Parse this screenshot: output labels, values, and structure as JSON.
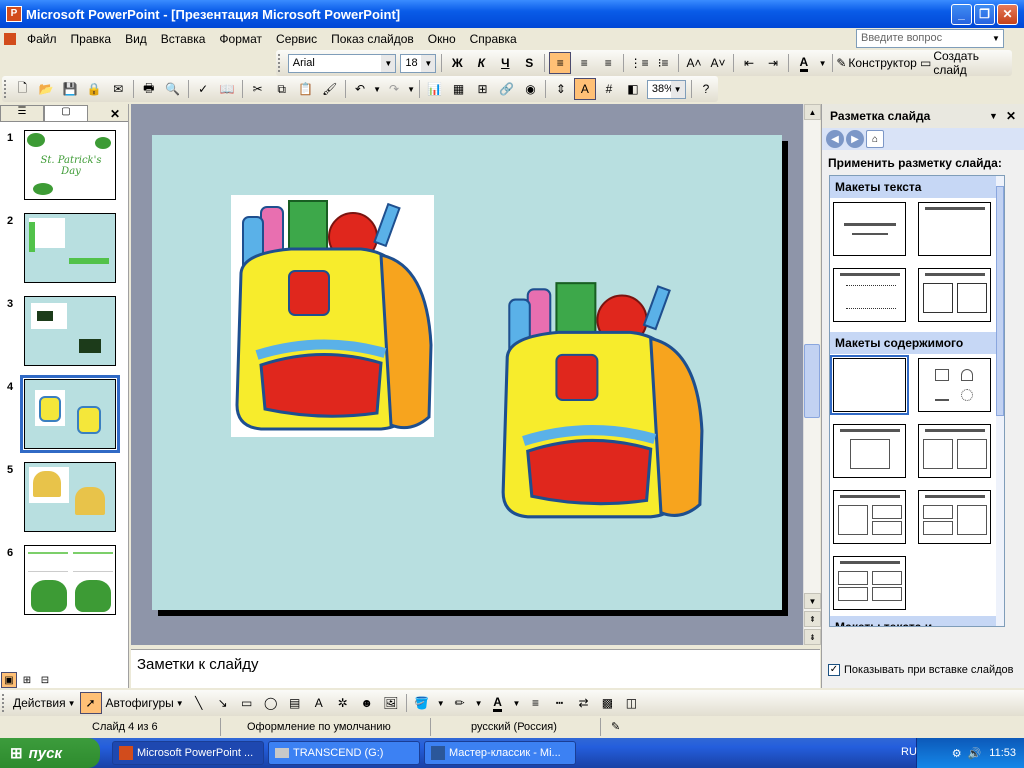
{
  "window": {
    "title": "Microsoft PowerPoint - [Презентация Microsoft PowerPoint]"
  },
  "menu": {
    "items": [
      "Файл",
      "Правка",
      "Вид",
      "Вставка",
      "Формат",
      "Сервис",
      "Показ слайдов",
      "Окно",
      "Справка"
    ],
    "ask_placeholder": "Введите вопрос"
  },
  "format_toolbar": {
    "font": "Arial",
    "size": "18",
    "bold": "Ж",
    "italic": "К",
    "underline": "Ч",
    "shadow": "S",
    "designer": "Конструктор",
    "new_slide": "Создать слайд"
  },
  "standard_toolbar": {
    "zoom": "38%"
  },
  "slides_pane": {
    "slides": [
      {
        "num": "1"
      },
      {
        "num": "2"
      },
      {
        "num": "3"
      },
      {
        "num": "4"
      },
      {
        "num": "5"
      },
      {
        "num": "6"
      }
    ],
    "thumb1_text": "St. Patrick's Day"
  },
  "notes": {
    "placeholder": "Заметки к слайду"
  },
  "task_pane": {
    "title": "Разметка слайда",
    "apply_label": "Применить разметку слайда:",
    "sections": {
      "text": "Макеты текста",
      "content": "Макеты содержимого",
      "text_content": "Макеты текста и содержимого"
    },
    "show_on_insert": "Показывать при вставке слайдов"
  },
  "draw_toolbar": {
    "actions": "Действия",
    "autoshapes": "Автофигуры"
  },
  "status": {
    "slide": "Слайд 4 из 6",
    "design": "Оформление по умолчанию",
    "lang": "русский (Россия)"
  },
  "taskbar": {
    "start": "пуск",
    "tasks": [
      "Microsoft PowerPoint ...",
      "TRANSCEND (G:)",
      "Мастер-классик - Mi..."
    ],
    "lang": "RU",
    "time": "11:53"
  }
}
